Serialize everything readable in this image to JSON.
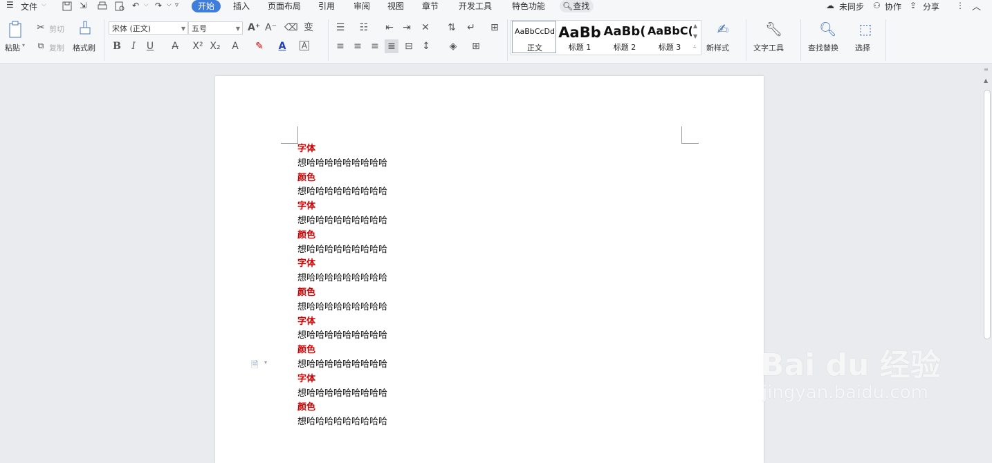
{
  "menubar": {
    "file": "文件",
    "tabs": [
      "开始",
      "插入",
      "页面布局",
      "引用",
      "审阅",
      "视图",
      "章节",
      "开发工具",
      "特色功能"
    ],
    "search": "查找",
    "right": {
      "sync": "未同步",
      "collab": "协作",
      "share": "分享"
    }
  },
  "toolbar": {
    "paste": "粘贴",
    "cut": "剪切",
    "copy": "复制",
    "format_painter": "格式刷",
    "font_name": "宋体 (正文)",
    "font_size": "五号",
    "styles": [
      {
        "preview": "AaBbCcDd",
        "name": "正文"
      },
      {
        "preview": "AaBb",
        "name": "标题 1"
      },
      {
        "preview": "AaBb(",
        "name": "标题 2"
      },
      {
        "preview": "AaBbC(",
        "name": "标题 3"
      }
    ],
    "new_style": "新样式",
    "text_tools": "文字工具",
    "find_replace": "查找替换",
    "select": "选择"
  },
  "document": {
    "lines": [
      {
        "text": "字体",
        "type": "head"
      },
      {
        "text": "想哈哈哈哈哈哈哈哈哈",
        "type": "body"
      },
      {
        "text": "颜色",
        "type": "head"
      },
      {
        "text": "想哈哈哈哈哈哈哈哈哈",
        "type": "body"
      },
      {
        "text": "字体",
        "type": "head"
      },
      {
        "text": "想哈哈哈哈哈哈哈哈哈",
        "type": "body"
      },
      {
        "text": "颜色",
        "type": "head"
      },
      {
        "text": "想哈哈哈哈哈哈哈哈哈",
        "type": "body"
      },
      {
        "text": "字体",
        "type": "head"
      },
      {
        "text": "想哈哈哈哈哈哈哈哈哈",
        "type": "body"
      },
      {
        "text": "颜色",
        "type": "head"
      },
      {
        "text": "想哈哈哈哈哈哈哈哈哈",
        "type": "body"
      },
      {
        "text": "字体",
        "type": "head"
      },
      {
        "text": "想哈哈哈哈哈哈哈哈哈",
        "type": "body"
      },
      {
        "text": "颜色",
        "type": "head"
      },
      {
        "text": "想哈哈哈哈哈哈哈哈哈",
        "type": "body"
      },
      {
        "text": "字体",
        "type": "head"
      },
      {
        "text": "想哈哈哈哈哈哈哈哈哈",
        "type": "body"
      },
      {
        "text": "颜色",
        "type": "head"
      },
      {
        "text": "想哈哈哈哈哈哈哈哈哈",
        "type": "body"
      }
    ]
  },
  "watermark": {
    "brand": "Bai du 经验",
    "url": "jingyan.baidu.com"
  },
  "colors": {
    "accent": "#3f7ddc",
    "heading_red": "#d00000"
  }
}
